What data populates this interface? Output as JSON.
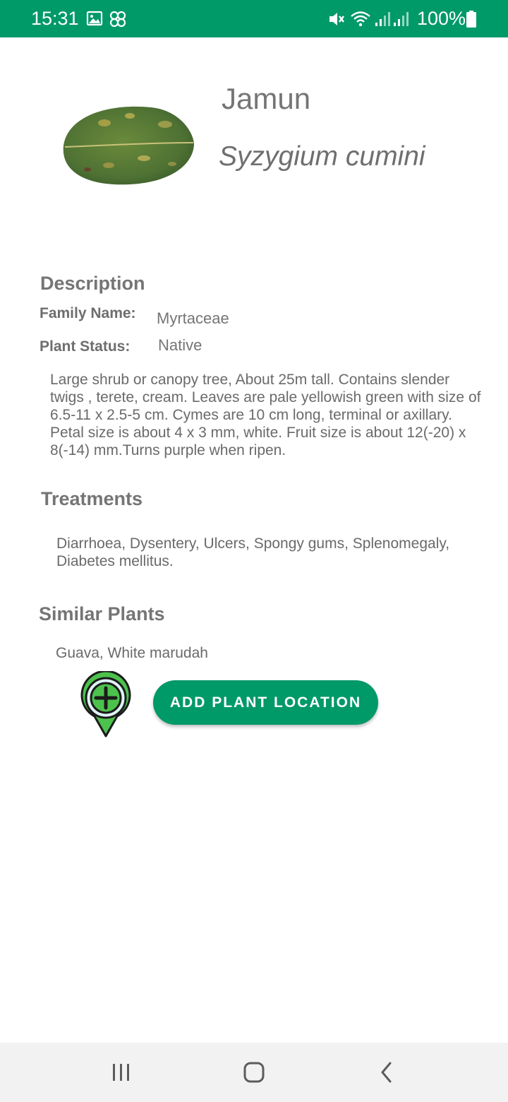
{
  "status_bar": {
    "time": "15:31",
    "battery_percent": "100%",
    "background_color": "#009968",
    "icons": [
      "gallery-icon",
      "app-icon",
      "mute-icon",
      "wifi-icon",
      "signal-icon",
      "signal-icon",
      "battery-icon"
    ]
  },
  "plant": {
    "common_name": "Jamun",
    "scientific_name": "Syzygium cumini",
    "image_icon": "leaf-image"
  },
  "description": {
    "heading": "Description",
    "family_label": "Family Name:",
    "family_value": "Myrtaceae",
    "status_label": "Plant Status:",
    "status_value": "Native",
    "text": "Large shrub or canopy tree, About 25m tall. Contains slender twigs , terete, cream. Leaves are pale yellowish green with size of 6.5-11 x 2.5-5 cm. Cymes are 10 cm long, terminal or axillary. Petal size is about 4 x 3 mm, white. Fruit size is about 12(-20) x 8(-14) mm.Turns purple when ripen."
  },
  "treatments": {
    "heading": "Treatments",
    "text": "Diarrhoea, Dysentery, Ulcers, Spongy gums, Splenomegaly, Diabetes mellitus."
  },
  "similar": {
    "heading": "Similar Plants",
    "text": "Guava, White marudah"
  },
  "actions": {
    "add_location_label": "ADD PLANT LOCATION",
    "add_location_icon": "add-location-pin-icon",
    "accent_color": "#009968"
  },
  "nav_bar": {
    "icons": [
      "recents-icon",
      "home-icon",
      "back-icon"
    ]
  }
}
